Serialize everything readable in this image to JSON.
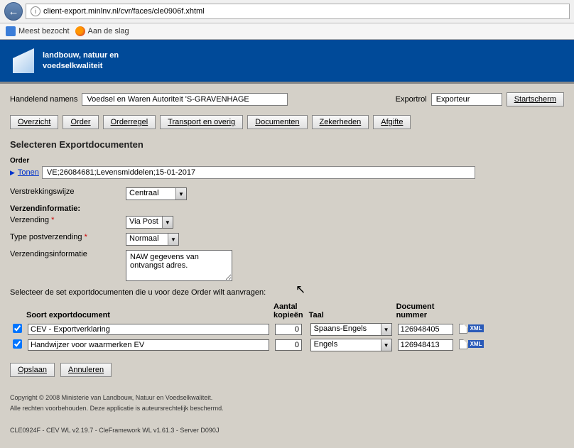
{
  "browser": {
    "url": "client-export.minlnv.nl/cvr/faces/cle0906f.xhtml",
    "bookmarks": {
      "most_visited": "Meest bezocht",
      "getting_started": "Aan de slag"
    }
  },
  "banner": {
    "line1": "landbouw, natuur en",
    "line2": "voedselkwaliteit"
  },
  "top": {
    "handelend_label": "Handelend namens",
    "handelend_value": "Voedsel en Waren Autoriteit 'S-GRAVENHAGE",
    "exportrol_label": "Exportrol",
    "exportrol_value": "Exporteur",
    "startscherm": "Startscherm"
  },
  "nav": {
    "overzicht": "Overzicht",
    "order": "Order",
    "orderregel": "Orderregel",
    "transport": "Transport en overig",
    "documenten": "Documenten",
    "zekerheden": "Zekerheden",
    "afgifte": "Afgifte"
  },
  "page_title": "Selecteren Exportdocumenten",
  "order": {
    "label": "Order",
    "tonen": "Tonen",
    "value": "VE;26084681;Levensmiddelen;15-01-2017"
  },
  "form": {
    "verstrek_label": "Verstrekkingswijze",
    "verstrek_value": "Centraal",
    "verzendinfo_head": "Verzendinformatie:",
    "verzending_label": "Verzending",
    "verzending_value": "Via Post",
    "typepost_label": "Type postverzending",
    "typepost_value": "Normaal",
    "verzendinfo_label": "Verzendingsinformatie",
    "verzendinfo_value": "NAW gegevens van ontvangst adres."
  },
  "instruction": "Selecteer de set exportdocumenten die u voor deze Order wilt aanvragen:",
  "table": {
    "h_soort": "Soort exportdocument",
    "h_aantal1": "Aantal",
    "h_aantal2": "kopieën",
    "h_taal": "Taal",
    "h_docnum1": "Document",
    "h_docnum2": "nummer",
    "rows": [
      {
        "name": "CEV - Exportverklaring",
        "copies": "0",
        "lang": "Spaans-Engels",
        "docnum": "126948405",
        "xml": "XML"
      },
      {
        "name": "Handwijzer voor waarmerken EV",
        "copies": "0",
        "lang": "Engels",
        "docnum": "126948413",
        "xml": "XML"
      }
    ]
  },
  "actions": {
    "opslaan": "Opslaan",
    "annuleren": "Annuleren"
  },
  "footer": {
    "line1": "Copyright © 2008 Ministerie van Landbouw, Natuur en Voedselkwaliteit.",
    "line2": "Alle rechten voorbehouden. Deze applicatie is auteursrechtelijk beschermd.",
    "line3": "CLE0924F - CEV WL v2.19.7 - CleFramework WL v1.61.3 - Server D090J"
  }
}
